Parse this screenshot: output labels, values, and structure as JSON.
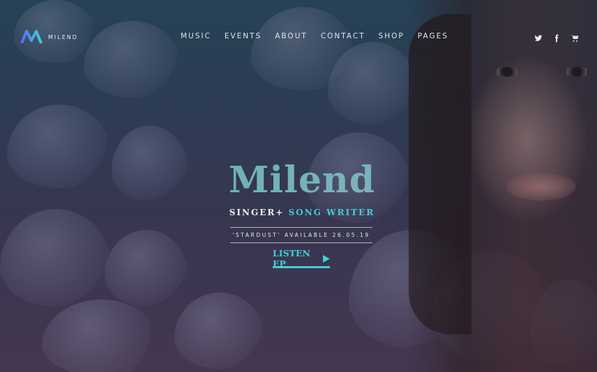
{
  "brand": {
    "name": "MILEND",
    "logo_colors": [
      "#5b6bff",
      "#3fd0d4"
    ]
  },
  "nav": {
    "items": [
      "MUSIC",
      "EVENTS",
      "ABOUT",
      "CONTACT",
      "SHOP",
      "PAGES"
    ]
  },
  "social": [
    "twitter-icon",
    "facebook-icon",
    "cart-icon"
  ],
  "hero": {
    "title": "Milend",
    "subtitle_left": "SINGER+",
    "subtitle_right": "SONG WRITER",
    "release": "'STARDUST' AVAILABLE 26.05.19",
    "cta_label": "LISTEN EP"
  },
  "colors": {
    "accent": "#3fd0d4",
    "text": "#e8ecf0"
  }
}
